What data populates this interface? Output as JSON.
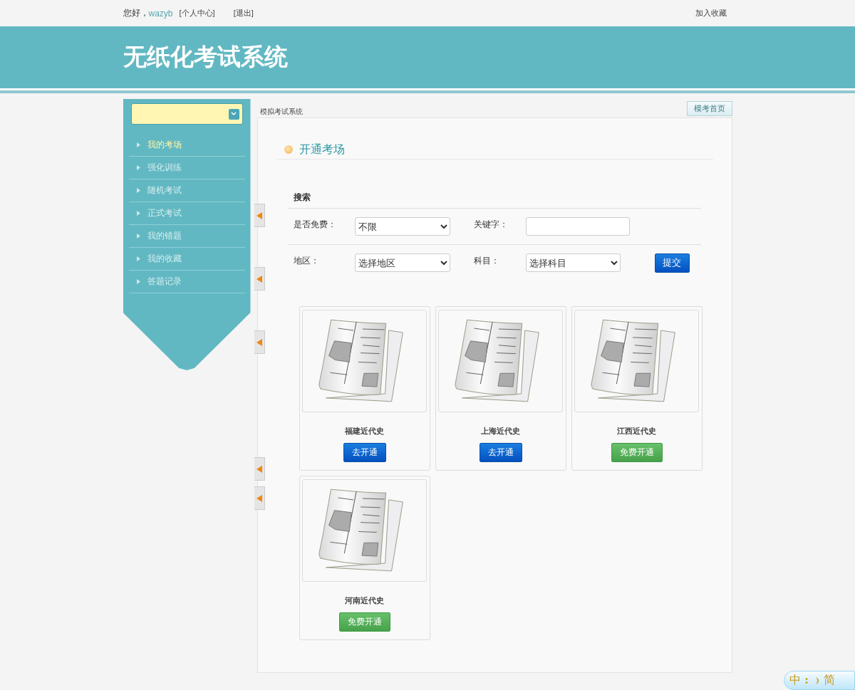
{
  "top_bar": {
    "greeting": "您好，",
    "username": "wazyb",
    "links": [
      "[个人中心]",
      "[退出]"
    ],
    "bookmark": "加入收藏"
  },
  "header": {
    "title": "无纸化考试系统"
  },
  "sidebar": {
    "items": [
      {
        "label": "我的考场",
        "selected": true
      },
      {
        "label": "强化训练",
        "selected": false
      },
      {
        "label": "随机考试",
        "selected": false
      },
      {
        "label": "正式考试",
        "selected": false
      },
      {
        "label": "我的错题",
        "selected": false
      },
      {
        "label": "我的收藏",
        "selected": false
      },
      {
        "label": "答题记录",
        "selected": false
      }
    ]
  },
  "breadcrumb": "模拟考试系统",
  "home_button": "模考首页",
  "section_title": "开通考场",
  "search": {
    "title": "搜索",
    "free_label": "是否免费：",
    "free_value": "不限",
    "keyword_label": "关键字：",
    "region_label": "地区：",
    "region_value": "选择地区",
    "subject_label": "科目：",
    "subject_value": "选择科目",
    "submit": "提交"
  },
  "cards": [
    {
      "title": "福建近代史",
      "button": "去开通",
      "kind": "paid"
    },
    {
      "title": "上海近代史",
      "button": "去开通",
      "kind": "paid"
    },
    {
      "title": "江西近代史",
      "button": "免费开通",
      "kind": "free"
    },
    {
      "title": "河南近代史",
      "button": "免费开通",
      "kind": "free"
    }
  ],
  "ime_bar": {
    "mode": "中",
    "script": "简"
  }
}
